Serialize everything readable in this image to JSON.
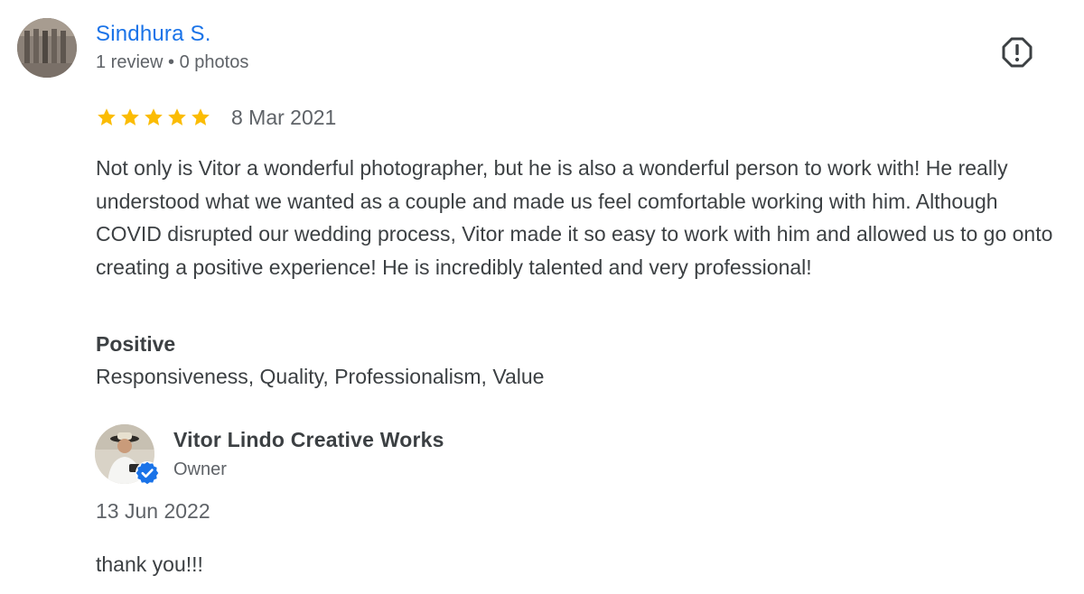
{
  "reviewer": {
    "name": "Sindhura S.",
    "meta": "1 review • 0 photos",
    "avatar_icon": "reviewer-photo"
  },
  "review": {
    "rating": 5,
    "rating_max": 5,
    "star_color": "#fbbc04",
    "date": "8 Mar 2021",
    "text": "Not only is Vitor a wonderful photographer, but he is also a wonderful person to work with! He really understood what we wanted as a couple and made us feel comfortable working with him. Although COVID disrupted our wedding process, Vitor made it so easy to work with him and allowed us to go onto creating a positive experience! He is incredibly talented and very professional!",
    "aspect_heading": "Positive",
    "aspects": "Responsiveness, Quality, Professionalism, Value"
  },
  "actions": {
    "report_icon": "report-flag-icon"
  },
  "owner_reply": {
    "name": "Vitor Lindo Creative Works",
    "role": "Owner",
    "verified": true,
    "badge_color": "#1a73e8",
    "date": "13 Jun 2022",
    "text": "thank you!!!"
  },
  "colors": {
    "link": "#1a73e8",
    "text": "#3c4043",
    "secondary": "#5f6368"
  }
}
